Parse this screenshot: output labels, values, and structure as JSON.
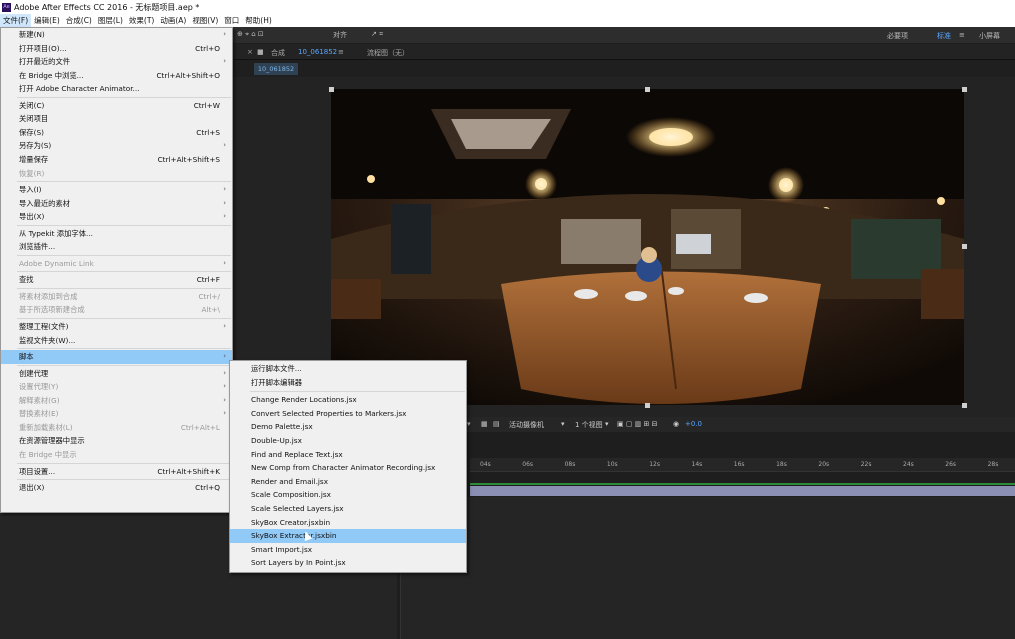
{
  "window": {
    "title": "Adobe After Effects CC 2016 - 无标题项目.aep *",
    "logo": "Ae"
  },
  "menubar": [
    "文件(F)",
    "编辑(E)",
    "合成(C)",
    "图层(L)",
    "效果(T)",
    "动画(A)",
    "视图(V)",
    "窗口",
    "帮助(H)"
  ],
  "toolbar": {
    "snap_label": "对齐",
    "workspaces": [
      "必要项",
      "标准",
      "小屏幕"
    ],
    "active_workspace": "标准"
  },
  "comp": {
    "panel_label": "合成",
    "comp_name": "10_061852",
    "flow_label": "流程图（无）",
    "sub_tab": "10_061852"
  },
  "viewer_bar": {
    "camera": "活动摄像机",
    "views": "1 个视图",
    "exposure": "+0.0"
  },
  "timeline": {
    "ticks": [
      "04s",
      "06s",
      "08s",
      "10s",
      "12s",
      "14s",
      "16s",
      "18s",
      "20s",
      "22s",
      "24s",
      "26s",
      "28s"
    ]
  },
  "file_menu": [
    {
      "label": "新建(N)",
      "shortcut": "",
      "arrow": true,
      "disabled": false
    },
    {
      "label": "打开项目(O)...",
      "shortcut": "Ctrl+O",
      "arrow": false,
      "disabled": false
    },
    {
      "label": "打开最近的文件",
      "shortcut": "",
      "arrow": true,
      "disabled": false
    },
    {
      "label": "在 Bridge 中浏览...",
      "shortcut": "Ctrl+Alt+Shift+O",
      "arrow": false,
      "disabled": false
    },
    {
      "label": "打开 Adobe Character Animator...",
      "shortcut": "",
      "arrow": false,
      "disabled": false
    },
    {
      "sep": true
    },
    {
      "label": "关闭(C)",
      "shortcut": "Ctrl+W",
      "arrow": false,
      "disabled": false
    },
    {
      "label": "关闭项目",
      "shortcut": "",
      "arrow": false,
      "disabled": false
    },
    {
      "label": "保存(S)",
      "shortcut": "Ctrl+S",
      "arrow": false,
      "disabled": false
    },
    {
      "label": "另存为(S)",
      "shortcut": "",
      "arrow": true,
      "disabled": false
    },
    {
      "label": "增量保存",
      "shortcut": "Ctrl+Alt+Shift+S",
      "arrow": false,
      "disabled": false
    },
    {
      "label": "恢复(R)",
      "shortcut": "",
      "arrow": false,
      "disabled": true
    },
    {
      "sep": true
    },
    {
      "label": "导入(I)",
      "shortcut": "",
      "arrow": true,
      "disabled": false
    },
    {
      "label": "导入最近的素材",
      "shortcut": "",
      "arrow": true,
      "disabled": false
    },
    {
      "label": "导出(X)",
      "shortcut": "",
      "arrow": true,
      "disabled": false
    },
    {
      "sep": true
    },
    {
      "label": "从 Typekit 添加字体...",
      "shortcut": "",
      "arrow": false,
      "disabled": false
    },
    {
      "label": "浏览插件...",
      "shortcut": "",
      "arrow": false,
      "disabled": false
    },
    {
      "sep": true
    },
    {
      "label": "Adobe Dynamic Link",
      "shortcut": "",
      "arrow": true,
      "disabled": true
    },
    {
      "sep": true
    },
    {
      "label": "查找",
      "shortcut": "Ctrl+F",
      "arrow": false,
      "disabled": false
    },
    {
      "sep": true
    },
    {
      "label": "将素材添加到合成",
      "shortcut": "Ctrl+/",
      "arrow": false,
      "disabled": true
    },
    {
      "label": "基于所选项新建合成",
      "shortcut": "Alt+\\",
      "arrow": false,
      "disabled": true
    },
    {
      "sep": true
    },
    {
      "label": "整理工程(文件)",
      "shortcut": "",
      "arrow": true,
      "disabled": false
    },
    {
      "label": "监视文件夹(W)...",
      "shortcut": "",
      "arrow": false,
      "disabled": false
    },
    {
      "sep": true
    },
    {
      "label": "脚本",
      "shortcut": "",
      "arrow": true,
      "disabled": false,
      "highlight": true
    },
    {
      "sep": true
    },
    {
      "label": "创建代理",
      "shortcut": "",
      "arrow": true,
      "disabled": false
    },
    {
      "label": "设置代理(Y)",
      "shortcut": "",
      "arrow": true,
      "disabled": true
    },
    {
      "label": "解释素材(G)",
      "shortcut": "",
      "arrow": true,
      "disabled": true
    },
    {
      "label": "替换素材(E)",
      "shortcut": "",
      "arrow": true,
      "disabled": true
    },
    {
      "label": "重新加载素材(L)",
      "shortcut": "Ctrl+Alt+L",
      "arrow": false,
      "disabled": true
    },
    {
      "label": "在资源管理器中显示",
      "shortcut": "",
      "arrow": false,
      "disabled": false
    },
    {
      "label": "在 Bridge 中显示",
      "shortcut": "",
      "arrow": false,
      "disabled": true
    },
    {
      "sep": true
    },
    {
      "label": "项目设置...",
      "shortcut": "Ctrl+Alt+Shift+K",
      "arrow": false,
      "disabled": false
    },
    {
      "sep": true
    },
    {
      "label": "退出(X)",
      "shortcut": "Ctrl+Q",
      "arrow": false,
      "disabled": false
    }
  ],
  "script_menu": [
    {
      "label": "运行脚本文件..."
    },
    {
      "label": "打开脚本编辑器"
    },
    {
      "sep": true
    },
    {
      "label": "Change Render Locations.jsx"
    },
    {
      "label": "Convert Selected Properties to Markers.jsx"
    },
    {
      "label": "Demo Palette.jsx"
    },
    {
      "label": "Double-Up.jsx"
    },
    {
      "label": "Find and Replace Text.jsx"
    },
    {
      "label": "New Comp from Character Animator Recording.jsx"
    },
    {
      "label": "Render and Email.jsx"
    },
    {
      "label": "Scale Composition.jsx"
    },
    {
      "label": "Scale Selected Layers.jsx"
    },
    {
      "label": "SkyBox Creator.jsxbin"
    },
    {
      "label": "SkyBox Extractor.jsxbin",
      "highlight": true
    },
    {
      "label": "Smart Import.jsx"
    },
    {
      "label": "Sort Layers by In Point.jsx"
    }
  ]
}
